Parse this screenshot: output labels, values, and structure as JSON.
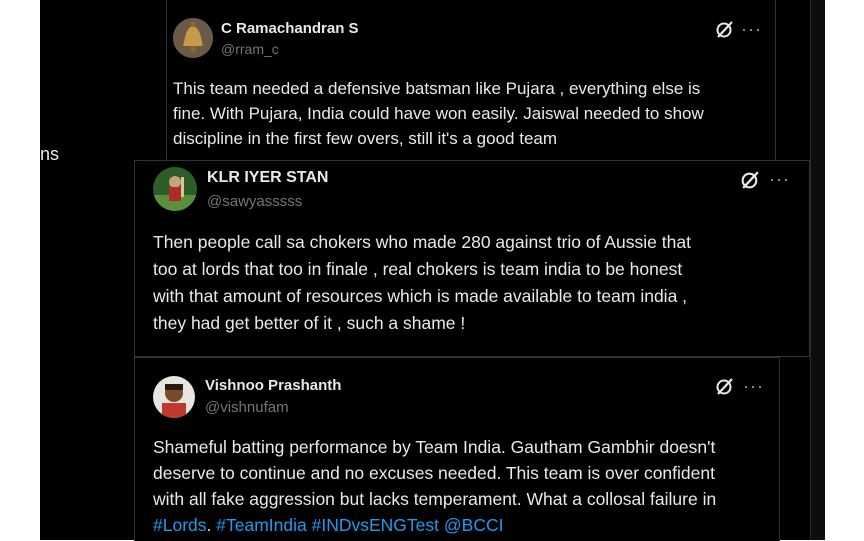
{
  "side_fragment": "ns",
  "posts": [
    {
      "name": "C Ramachandran S",
      "handle": "@rram_c",
      "text": "This team needed a defensive batsman like Pujara , everything else is\nfine. With Pujara, India could have won easily. Jaiswal needed to show\ndiscipline in the first few overs, still it's a good team",
      "avatar": "bell-avatar",
      "more_label": "···"
    },
    {
      "name": "KLR IYER STAN",
      "handle": "@sawyasssss",
      "text": "Then people call sa chokers who made 280 against trio of Aussie that\ntoo at lords that too in finale , real chokers is team india to be honest\nwith that amount of resources which is made available to team india ,\nthey had get better of it , such a shame !",
      "avatar": "cricket-player-avatar",
      "more_label": "···"
    },
    {
      "name": "Vishnoo Prashanth",
      "handle": "@vishnufam",
      "text_lines": [
        "Shameful batting performance by Team India. Gautham Gambhir doesn't",
        "deserve to continue and no excuses needed. This team is over confident",
        "with all fake aggression but lacks temperament. What a collosal failure in"
      ],
      "hashtags": [
        "#Lords",
        ".",
        "#TeamIndia",
        "#INDvsENGTest",
        "@BCCI"
      ],
      "avatar": "person-avatar",
      "more_label": "···"
    }
  ],
  "colors": {
    "background": "#000000",
    "text": "#e7e9ea",
    "muted": "#71767b",
    "link": "#1d9bf0"
  },
  "icons": [
    "grok-slash-icon",
    "more-options-icon"
  ]
}
